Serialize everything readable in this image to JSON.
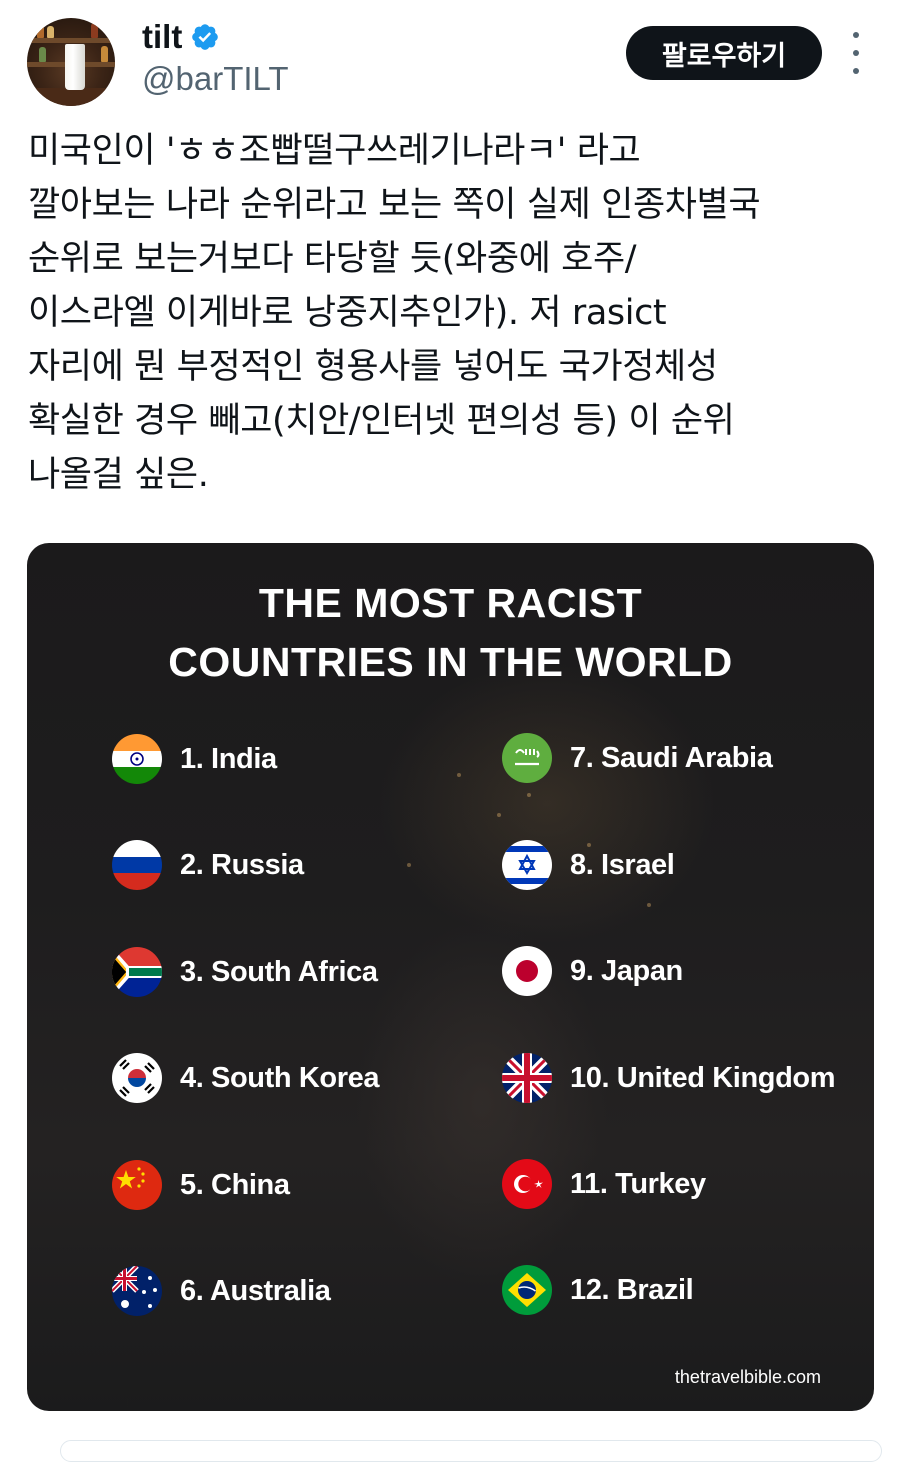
{
  "author": {
    "name": "tilt",
    "handle": "@barTILT",
    "verified_icon": "verified-badge-icon"
  },
  "actions": {
    "follow_label": "팔로우하기",
    "more_icon": "more-options-icon"
  },
  "tweet": {
    "text": "미국인이 'ㅎㅎ조빱떨구쓰레기나라ㅋ' 라고\n깔아보는 나라 순위라고 보는 쪽이 실제 인종차별국\n순위로 보는거보다 타당할 듯(와중에 호주/\n이스라엘 이게바로 낭중지추인가). 저 rasict\n자리에 뭔 부정적인 형용사를 넣어도 국가정체성\n확실한 경우 빼고(치안/인터넷 편의성 등) 이 순위\n나올걸 싶은."
  },
  "image": {
    "title_line1": "THE MOST RACIST",
    "title_line2": "COUNTRIES IN THE WORLD",
    "source": "thetravelbible.com",
    "left_column": [
      {
        "label": "1. India",
        "flag": "india-flag-icon"
      },
      {
        "label": "2. Russia",
        "flag": "russia-flag-icon"
      },
      {
        "label": "3. South Africa",
        "flag": "south-africa-flag-icon"
      },
      {
        "label": "4. South Korea",
        "flag": "south-korea-flag-icon"
      },
      {
        "label": "5. China",
        "flag": "china-flag-icon"
      },
      {
        "label": "6. Australia",
        "flag": "australia-flag-icon"
      }
    ],
    "right_column": [
      {
        "label": "7. Saudi Arabia",
        "flag": "saudi-arabia-flag-icon"
      },
      {
        "label": "8. Israel",
        "flag": "israel-flag-icon"
      },
      {
        "label": "9. Japan",
        "flag": "japan-flag-icon"
      },
      {
        "label": "10. United Kingdom",
        "flag": "united-kingdom-flag-icon"
      },
      {
        "label": "11. Turkey",
        "flag": "turkey-flag-icon"
      },
      {
        "label": "12. Brazil",
        "flag": "brazil-flag-icon"
      }
    ]
  },
  "colors": {
    "text": "#0f1419",
    "secondary_text": "#536471",
    "verified_blue": "#1d9bf0",
    "follow_button": "#0f1419",
    "image_background": "#1e1d1e"
  }
}
